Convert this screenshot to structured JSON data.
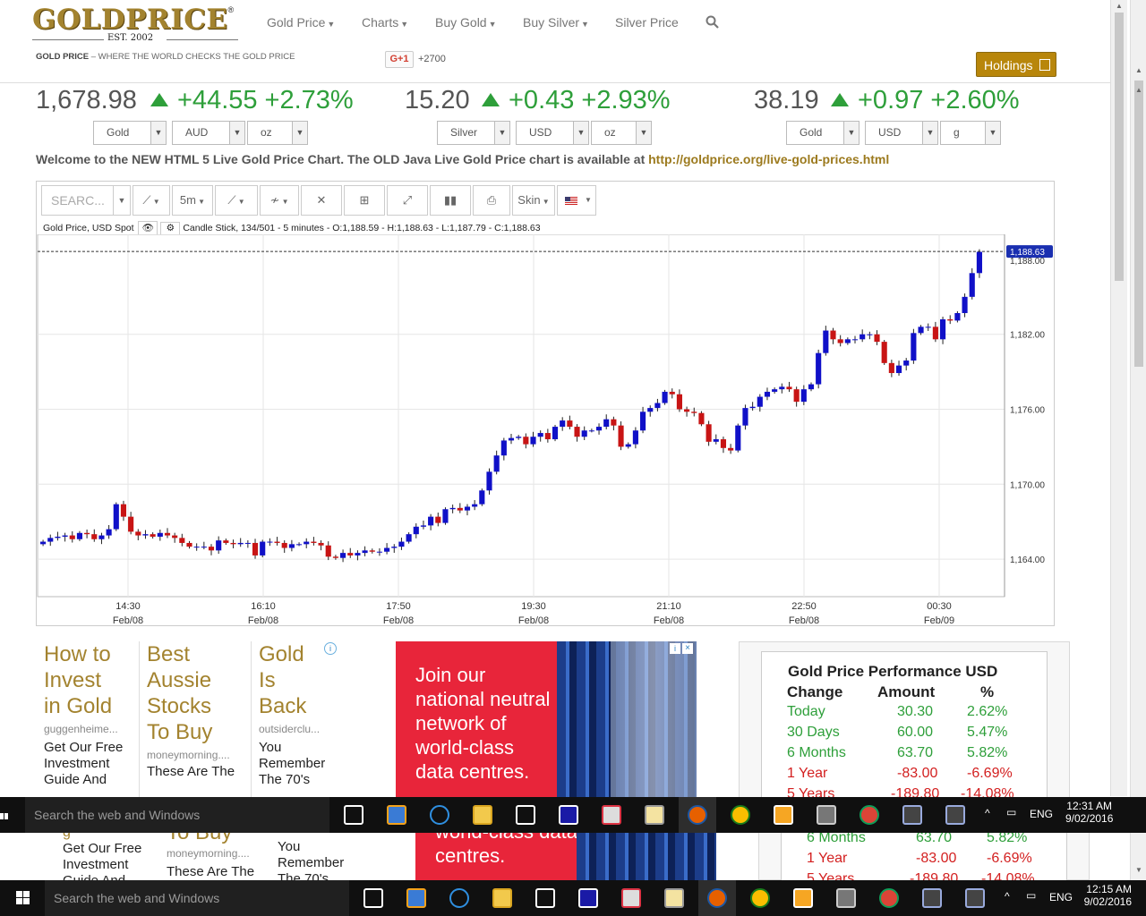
{
  "header": {
    "logo_text": "GOLDPRICE",
    "logo_est": "EST. 2002",
    "nav": [
      {
        "label": "Gold Price",
        "has_caret": true
      },
      {
        "label": "Charts",
        "has_caret": true
      },
      {
        "label": "Buy Gold",
        "has_caret": true
      },
      {
        "label": "Buy Silver",
        "has_caret": true
      },
      {
        "label": "Silver Price",
        "has_caret": false
      }
    ],
    "search_icon": "search-icon",
    "tagline_bold": "GOLD PRICE",
    "tagline_rest": " – WHERE THE WORLD CHECKS THE GOLD PRICE",
    "gplus_label": "G+1",
    "gplus_count": "+2700",
    "holdings_label": "Holdings",
    "holdings_icon": "calculator-icon"
  },
  "tickers": [
    {
      "price": "1,678.98",
      "change": "+44.55",
      "pct": "+2.73%",
      "direction": "up",
      "selects": [
        "Gold",
        "AUD",
        "oz"
      ]
    },
    {
      "price": "15.20",
      "change": "+0.43",
      "pct": "+2.93%",
      "direction": "up",
      "selects": [
        "Silver",
        "USD",
        "oz"
      ]
    },
    {
      "price": "38.19",
      "change": "+0.97",
      "pct": "+2.60%",
      "direction": "up",
      "selects": [
        "Gold",
        "USD",
        "g"
      ]
    }
  ],
  "welcome": {
    "text": "Welcome to the NEW HTML 5 Live Gold Price Chart. The OLD Java Live Gold Price chart is available at ",
    "link": "http://goldprice.org/live-gold-prices.html"
  },
  "toolbar": {
    "search_placeholder": "SEARC...",
    "interval": "5m",
    "skin": "Skin"
  },
  "chart_info": {
    "series_label": "Gold Price, USD Spot",
    "ohlc": "Candle Stick, 134/501 - 5 minutes - O:1,188.59 - H:1,188.63 - L:1,187.79 - C:1,188.63",
    "last_price_label": "1,188.63",
    "partial_tick": "1,188.00"
  },
  "chart_data": {
    "type": "candlestick",
    "title": "Gold Price, USD Spot",
    "interval": "5 minutes",
    "ylim": [
      1161,
      1190
    ],
    "y_ticks": [
      "1,182.00",
      "1,176.00",
      "1,170.00",
      "1,164.00"
    ],
    "x_ticks": [
      {
        "time": "14:30",
        "date": "Feb/08"
      },
      {
        "time": "16:10",
        "date": "Feb/08"
      },
      {
        "time": "17:50",
        "date": "Feb/08"
      },
      {
        "time": "19:30",
        "date": "Feb/08"
      },
      {
        "time": "21:10",
        "date": "Feb/08"
      },
      {
        "time": "22:50",
        "date": "Feb/08"
      },
      {
        "time": "00:30",
        "date": "Feb/09"
      }
    ],
    "last_close": 1188.63,
    "closes": [
      1165.4,
      1165.7,
      1165.8,
      1165.9,
      1165.6,
      1166.1,
      1166.0,
      1165.6,
      1165.9,
      1166.4,
      1168.4,
      1167.4,
      1166.2,
      1165.9,
      1166.0,
      1165.8,
      1166.1,
      1165.9,
      1165.7,
      1165.3,
      1165.0,
      1165.0,
      1165.0,
      1164.7,
      1165.5,
      1165.3,
      1165.2,
      1165.3,
      1165.3,
      1164.3,
      1165.4,
      1165.4,
      1165.3,
      1164.9,
      1165.2,
      1165.2,
      1165.4,
      1165.3,
      1165.1,
      1164.2,
      1164.1,
      1164.5,
      1164.3,
      1164.5,
      1164.7,
      1164.6,
      1164.6,
      1164.9,
      1165.0,
      1165.4,
      1166.0,
      1166.6,
      1166.7,
      1167.4,
      1166.9,
      1168.0,
      1168.1,
      1167.9,
      1168.2,
      1168.4,
      1169.5,
      1171.0,
      1172.3,
      1173.5,
      1173.7,
      1173.8,
      1173.2,
      1173.8,
      1174.1,
      1173.6,
      1174.6,
      1175.1,
      1174.6,
      1173.8,
      1174.3,
      1174.3,
      1174.6,
      1175.2,
      1174.7,
      1173.0,
      1173.2,
      1174.3,
      1175.8,
      1176.1,
      1176.5,
      1177.4,
      1177.2,
      1176.0,
      1175.8,
      1175.7,
      1174.8,
      1173.4,
      1173.6,
      1172.9,
      1172.7,
      1174.7,
      1176.1,
      1176.2,
      1177.0,
      1177.4,
      1177.6,
      1177.8,
      1177.6,
      1176.6,
      1177.6,
      1178.0,
      1180.5,
      1182.3,
      1181.6,
      1181.3,
      1181.6,
      1181.6,
      1182.0,
      1182.0,
      1181.4,
      1179.7,
      1178.9,
      1179.5,
      1179.9,
      1182.1,
      1182.6,
      1182.6,
      1181.6,
      1183.2,
      1183.1,
      1183.7,
      1185.0,
      1186.9,
      1188.6
    ]
  },
  "ads": [
    {
      "heading": "How to Invest in Gold",
      "lines": [
        "How to",
        "Invest",
        "in Gold"
      ],
      "source": "guggenheime...",
      "text": "Get Our Free Investment Guide And"
    },
    {
      "heading": "Best Aussie Stocks To Buy",
      "lines": [
        "Best",
        "Aussie",
        "Stocks",
        "To Buy"
      ],
      "source": "moneymorning....",
      "text": "These Are The"
    },
    {
      "heading": "Gold Is Back",
      "lines": [
        "Gold",
        "Is",
        "Back"
      ],
      "source": "outsiderclu...",
      "text": "You Remember The 70's"
    }
  ],
  "red_ad": {
    "lines": [
      "Join our",
      "national neutral",
      "network of",
      "world-class",
      "data centres."
    ]
  },
  "performance": {
    "title": "Gold Price Performance USD",
    "headers": [
      "Change",
      "Amount",
      "%"
    ],
    "rows": [
      {
        "label": "Today",
        "amount": "30.30",
        "pct": "2.62%",
        "dir": "up"
      },
      {
        "label": "30 Days",
        "amount": "60.00",
        "pct": "5.47%",
        "dir": "up"
      },
      {
        "label": "6 Months",
        "amount": "63.70",
        "pct": "5.82%",
        "dir": "up"
      },
      {
        "label": "1 Year",
        "amount": "-83.00",
        "pct": "-6.69%",
        "dir": "down"
      },
      {
        "label": "5 Years",
        "amount": "-189.80",
        "pct": "-14.08%",
        "dir": "down"
      }
    ]
  },
  "taskbar_upper": {
    "search": "Search the web and Windows",
    "lang": "ENG",
    "time": "12:31 AM",
    "date": "9/02/2016"
  },
  "taskbar_lower": {
    "search": "Search the web and Windows",
    "lang": "ENG",
    "time": "12:15 AM",
    "date": "9/02/2016"
  },
  "echo": {
    "ad1_text": "Get Our Free Investment Guide And",
    "ad1_fragment": "g",
    "ad2_heading": "To Buy",
    "ad2_source": "moneymorning....",
    "ad2_text": "These Are The",
    "ad3_text": "You Remember The 70's",
    "red_ad_text": "world-class data centres.",
    "perf_rows": [
      {
        "label": "6 Months",
        "amount": "63.70",
        "pct": "5.82%"
      },
      {
        "label": "1 Year",
        "amount": "-83.00",
        "pct": "-6.69%"
      },
      {
        "label": "5 Years",
        "amount": "-189.80",
        "pct": "-14.08%"
      }
    ]
  }
}
